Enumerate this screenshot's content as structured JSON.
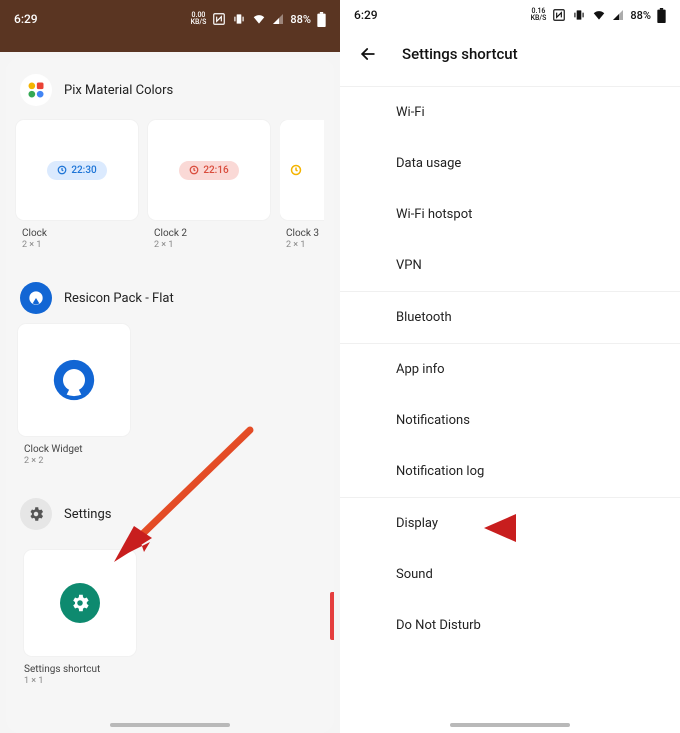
{
  "left": {
    "status": {
      "time": "6:29",
      "net_rate": "0.00",
      "net_unit": "KB/S",
      "battery": "88%"
    },
    "sections": {
      "pix": {
        "title": "Pix Material Colors",
        "cards": [
          {
            "time": "22:30",
            "color": "blue",
            "name": "Clock",
            "size": "2 × 1"
          },
          {
            "time": "22:16",
            "color": "red",
            "name": "Clock 2",
            "size": "2 × 1"
          },
          {
            "time": "",
            "color": "",
            "name": "Clock 3",
            "size": "2 × 1"
          }
        ]
      },
      "resicon": {
        "title": "Resicon Pack - Flat",
        "card": {
          "name": "Clock Widget",
          "size": "2 × 2"
        }
      },
      "settings": {
        "title": "Settings",
        "card": {
          "name": "Settings shortcut",
          "size": "1 × 1"
        }
      }
    }
  },
  "right": {
    "status": {
      "time": "6:29",
      "net_rate": "0.16",
      "net_unit": "KB/S",
      "battery": "88%"
    },
    "title": "Settings shortcut",
    "items": [
      "Wi-Fi",
      "Data usage",
      "Wi-Fi hotspot",
      "VPN",
      "Bluetooth",
      "App info",
      "Notifications",
      "Notification log",
      "Display",
      "Sound",
      "Do Not Disturb"
    ],
    "separators_after": [
      3,
      4,
      7
    ]
  }
}
